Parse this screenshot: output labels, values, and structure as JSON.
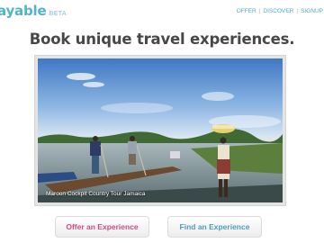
{
  "header": {
    "logo_text": "ayable",
    "beta_label": "BETA"
  },
  "nav": {
    "items": [
      "OFFER",
      "DISCOVER",
      "SIGNUP"
    ],
    "separator": "|"
  },
  "hero": {
    "headline": "Book unique travel experiences.",
    "photo_caption": "Maroon Cockpit Country Tour Jamaica"
  },
  "actions": {
    "offer_label": "Offer an Experience",
    "find_label": "Find an Experience"
  },
  "colors": {
    "brand_blue": "#52b3cf",
    "offer_pink": "#d24a86",
    "find_blue": "#4a9cc4"
  }
}
